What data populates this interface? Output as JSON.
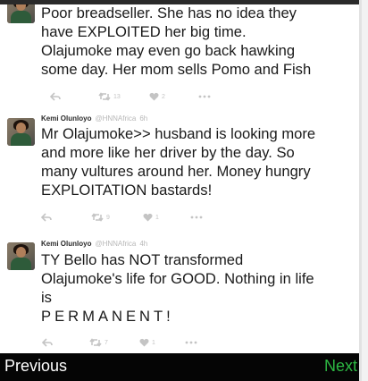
{
  "tweets": [
    {
      "name": "",
      "handle": "",
      "time": "",
      "lines": [
        "Poor breadseller. She has no idea they",
        "have EXPLOITED her big time.",
        "Olajumoke may even go back hawking",
        "some day. Her mom sells Pomo and Fish"
      ],
      "retweets": "13",
      "likes": "2"
    },
    {
      "name": "Kemi Olunloyo",
      "handle": "@HNNAfrica",
      "time": "6h",
      "lines": [
        "Mr Olajumoke>> husband is looking more",
        "and more like her driver by the day. So",
        "many vultures around her. Money hungry",
        "EXPLOITATION bastards!"
      ],
      "retweets": "9",
      "likes": "1"
    },
    {
      "name": "Kemi Olunloyo",
      "handle": "@HNNAfrica",
      "time": "4h",
      "lines": [
        "TY Bello has NOT transformed",
        "Olajumoke's life for GOOD. Nothing in life",
        "is",
        "PERMANENT!"
      ],
      "retweets": "7",
      "likes": "1"
    }
  ],
  "nav": {
    "previous": "Previous",
    "next": "Next"
  },
  "colors": {
    "next_accent": "#2db843",
    "bar_bg": "#050505",
    "icon_gray": "#c4c4c4"
  }
}
